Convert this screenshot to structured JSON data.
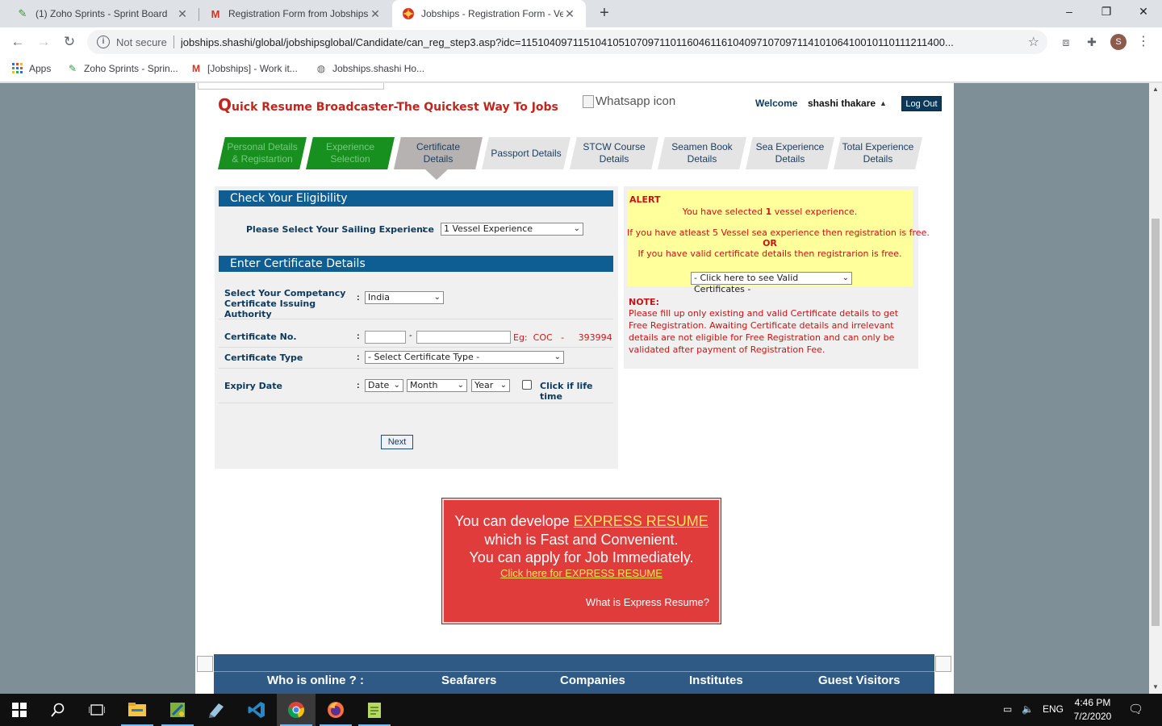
{
  "browser": {
    "tabs": [
      {
        "title": "(1) Zoho Sprints - Sprint Board",
        "icon": "zoho-sprints-icon"
      },
      {
        "title": "Registration Form from Jobships.",
        "icon": "gmail-icon"
      },
      {
        "title": "Jobships - Registration Form - Ve",
        "icon": "jobships-icon"
      }
    ],
    "new_tab": "+",
    "window_controls": {
      "minimize": "–",
      "maximize": "❐",
      "close": "✕"
    },
    "nav": {
      "back": "←",
      "forward": "→",
      "reload": "↻"
    },
    "security_label": "Not secure",
    "url": "jobships.shashi/global/jobshipsglobal/Candidate/can_reg_step3.asp?idc=11510409711510410510709711011604611610409710709711410106410010110111211400...",
    "avatar_letter": "S",
    "bookmarks": [
      {
        "label": "Apps",
        "icon": "apps-grid-icon"
      },
      {
        "label": "Zoho Sprints - Sprin...",
        "icon": "zoho-sprints-icon"
      },
      {
        "label": "[Jobships] - Work it...",
        "icon": "gmail-icon"
      },
      {
        "label": "Jobships.shashi Ho...",
        "icon": "globe-icon"
      }
    ]
  },
  "site": {
    "brand_first": "Q",
    "brand_rest": "uick Resume Broadcaster-The Quickest Way To Jobs",
    "whatsapp_alt": "Whatsapp icon",
    "welcome": "Welcome",
    "username": "shashi thakare",
    "logout": "Log Out",
    "steps": [
      {
        "label": "Personal Details & Registartion",
        "state": "done"
      },
      {
        "label": "Experience Selection",
        "state": "done"
      },
      {
        "label": "Certificate Details",
        "state": "current"
      },
      {
        "label": "Passport Details",
        "state": "todo"
      },
      {
        "label": "STCW Course Details",
        "state": "todo"
      },
      {
        "label": "Seamen Book Details",
        "state": "todo"
      },
      {
        "label": "Sea Experience Details",
        "state": "todo"
      },
      {
        "label": "Total Experience Details",
        "state": "todo"
      }
    ]
  },
  "form": {
    "eligibility_header": "Check Your Eligibility",
    "sailing_label": "Please Select Your Sailing Experience",
    "sailing_value": "1 Vessel Experience",
    "cert_header": "Enter Certificate Details",
    "authority_label": "Select Your Competancy Certificate Issuing Authority",
    "authority_value": "India",
    "cert_no_label": "Certificate No.",
    "cert_no_sep": "-",
    "cert_no_example": "Eg:  COC   -     393994",
    "cert_type_label": "Certificate Type",
    "cert_type_value": "- Select Certificate Type -",
    "expiry_label": "Expiry Date",
    "expiry_date": "Date",
    "expiry_month": "Month",
    "expiry_year": "Year",
    "lifetime_label": "Click if life time",
    "colon": ":",
    "next": "Next"
  },
  "alert": {
    "title": "ALERT",
    "selected_pre": "You have selected",
    "selected_num": "1",
    "selected_post": "vessel experience.",
    "line2": "If you have atleast 5 Vessel sea experience then registration is free.",
    "or": "OR",
    "line3": "If you have valid certificate details then registrarion is free.",
    "valid_cert_select": "- Click here to see Valid Certificates -",
    "note_title": "NOTE:",
    "note_text": "Please fill up only existing and valid Certificate details to get Free Registration. Awaiting Certificate details and irrelevant details are not eligible for Free Registration and can only be validated after payment of Registration Fee."
  },
  "express": {
    "line1_pre": "You can develope",
    "line1_hl": "EXPRESS RESUME",
    "line2": "which is Fast and Convenient.",
    "line3": "You can apply for Job Immediately.",
    "link": "Click here for EXPRESS RESUME",
    "what": "What is Express Resume?"
  },
  "footer": {
    "headings": [
      "Who is online ?  :",
      "Seafarers",
      "Companies",
      "Institutes",
      "Guest Visitors"
    ]
  },
  "taskbar": {
    "lang": "ENG",
    "time": "4:46 PM",
    "date": "7/2/2020"
  }
}
